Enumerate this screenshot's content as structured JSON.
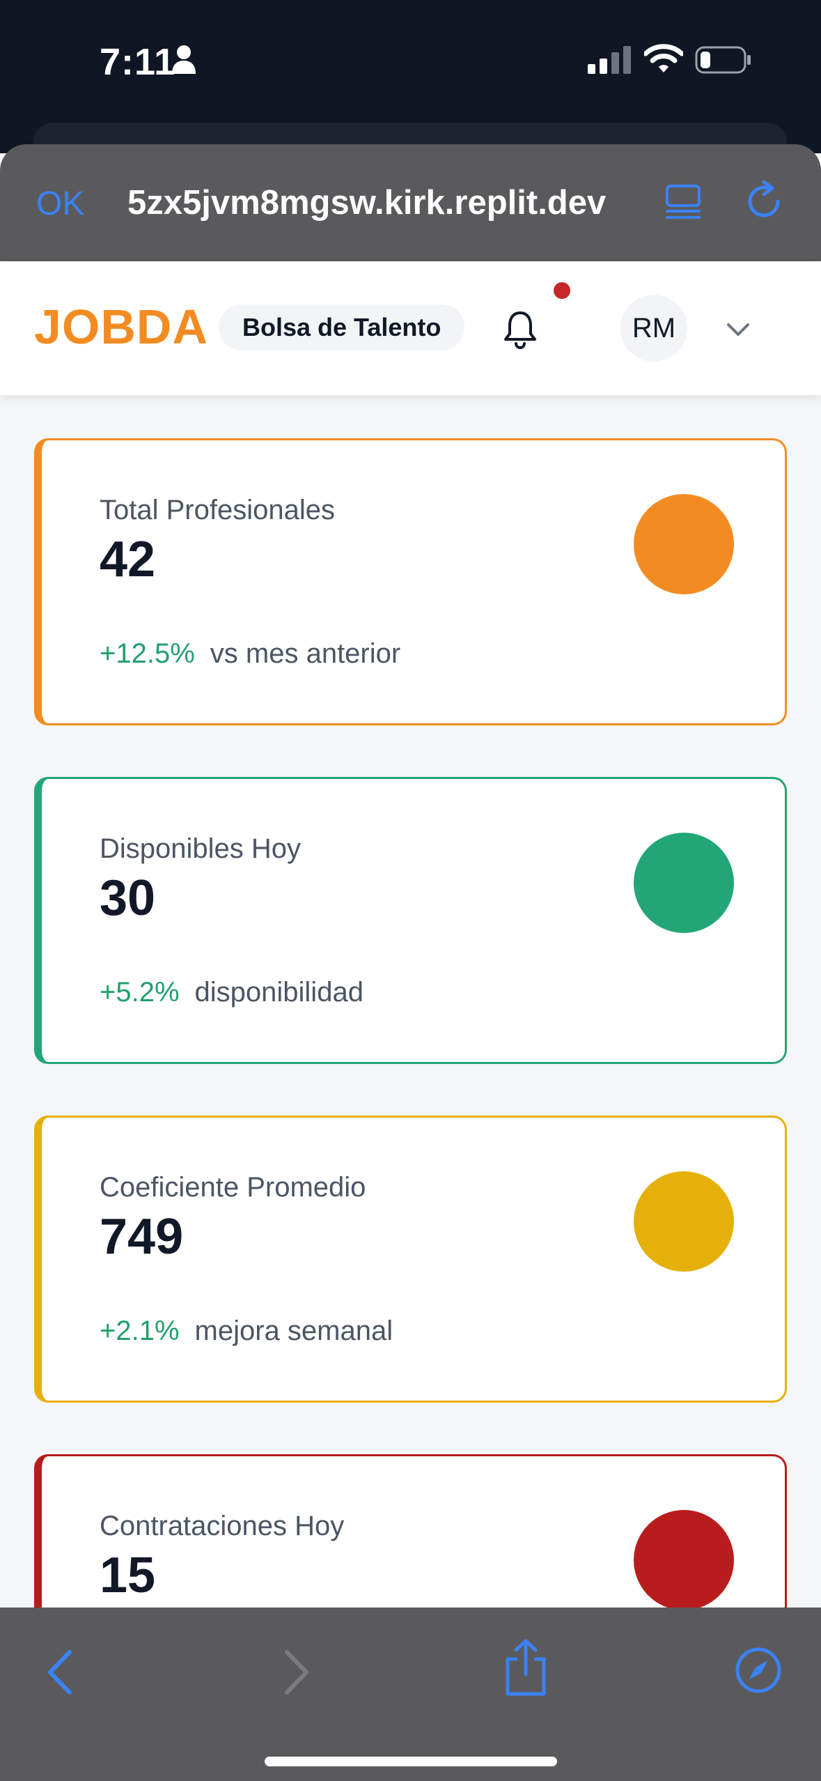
{
  "status_bar": {
    "time": "7:11"
  },
  "browser": {
    "ok_label": "OK",
    "url": "5zx5jvm8mgsw.kirk.replit.dev"
  },
  "header": {
    "logo": "JOBDA",
    "section_pill": "Bolsa de Talento",
    "avatar_initials": "RM",
    "has_notification": true
  },
  "cards": [
    {
      "label": "Total Profesionales",
      "value": "42",
      "change": "+12.5%",
      "note": "vs mes anterior",
      "accent": "#f28c22"
    },
    {
      "label": "Disponibles Hoy",
      "value": "30",
      "change": "+5.2%",
      "note": "disponibilidad",
      "accent": "#22a676"
    },
    {
      "label": "Coeficiente Promedio",
      "value": "749",
      "change": "+2.1%",
      "note": "mejora semanal",
      "accent": "#e6b00b"
    },
    {
      "label": "Contrataciones Hoy",
      "value": "15",
      "change": "",
      "note": "",
      "accent": "#b91c1c"
    }
  ],
  "colors": {
    "brand": "#f28c22",
    "positive": "#22a06b",
    "browser_accent": "#3b82f6"
  },
  "icons": [
    "person-icon",
    "signal-icon",
    "wifi-icon",
    "battery-icon",
    "reader-icon",
    "reload-icon",
    "bell-icon",
    "chevron-down-icon",
    "back-icon",
    "forward-icon",
    "share-icon",
    "compass-icon"
  ]
}
